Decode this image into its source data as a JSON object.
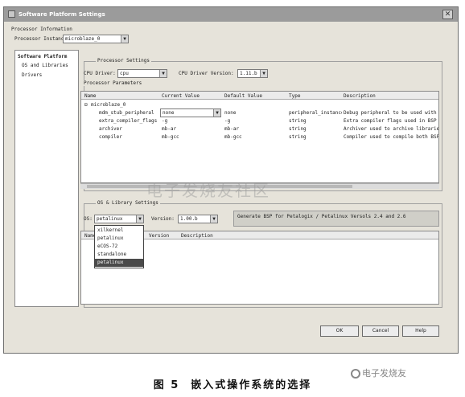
{
  "window": {
    "title": "Software Platform Settings",
    "close_glyph": "✕"
  },
  "processor_info": {
    "heading": "Processor Information",
    "instance_label": "Processor Instance:",
    "instance_value": "microblaze_0"
  },
  "sidebar": {
    "heading": "Software Platform",
    "items": [
      {
        "label": "OS and Libraries"
      },
      {
        "label": "Drivers"
      }
    ]
  },
  "processor_settings": {
    "heading": "Processor Settings",
    "cpu_driver_label": "CPU Driver:",
    "cpu_driver_value": "cpu",
    "cpu_driver_version_label": "CPU Driver Version:",
    "cpu_driver_version_value": "1.11.b",
    "params_heading": "Processor Parameters",
    "columns": [
      "Name",
      "Current Value",
      "Default Value",
      "Type",
      "Description"
    ],
    "tree_root": "microblaze_0",
    "rows": [
      {
        "name": "mdm_stub_peripheral",
        "current": "none",
        "default": "none",
        "type": "peripheral_instance",
        "description": "Debug peripheral to be used with x"
      },
      {
        "name": "extra_compiler_flags",
        "current": "-g",
        "default": "-g",
        "type": "string",
        "description": "Extra compiler flags used in BSP"
      },
      {
        "name": "archiver",
        "current": "mb-ar",
        "default": "mb-ar",
        "type": "string",
        "description": "Archiver used to archive librarie"
      },
      {
        "name": "compiler",
        "current": "mb-gcc",
        "default": "mb-gcc",
        "type": "string",
        "description": "Compiler used to compile both BSP"
      }
    ]
  },
  "os_library_settings": {
    "heading": "OS & Library Settings",
    "os_label": "OS:",
    "os_value": "petalinux",
    "version_label": "Version:",
    "version_value": "1.00.b",
    "os_description": "Generate BSP for Petalogix / Petalinux Versols 2.4 and 2.6",
    "columns": [
      "Name",
      "Version",
      "Description"
    ],
    "dropdown_options": [
      "xilkernel",
      "petalinux",
      "eCOS-72",
      "standalone",
      "petalinux"
    ],
    "selected_option_index": 4
  },
  "buttons": {
    "ok": "OK",
    "cancel": "Cancel",
    "help": "Help"
  },
  "caption": {
    "figure": "图 5",
    "text": "嵌入式操作系统的选择"
  },
  "watermark": "电子发烧友社区",
  "logo": "电子发烧友"
}
